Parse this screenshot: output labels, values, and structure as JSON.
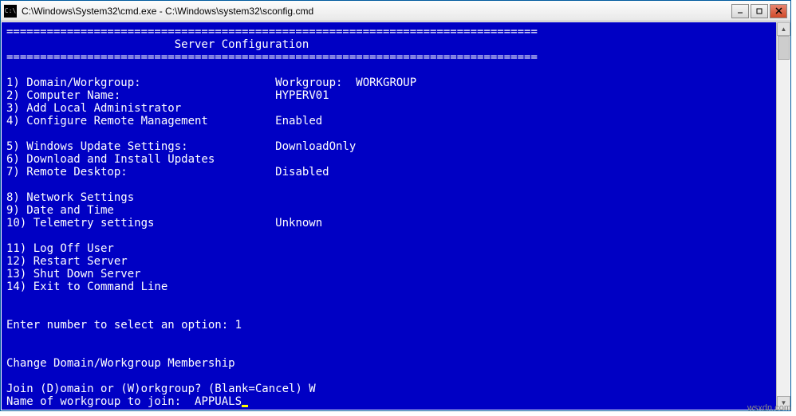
{
  "window": {
    "title": "C:\\Windows\\System32\\cmd.exe - C:\\Windows\\system32\\sconfig.cmd"
  },
  "header": {
    "rule": "===============================================================================",
    "title_indent": "                         ",
    "title": "Server Configuration"
  },
  "options": {
    "o1_label": "1) Domain/Workgroup:",
    "o1_value": "Workgroup:  WORKGROUP",
    "o2_label": "2) Computer Name:",
    "o2_value": "HYPERV01",
    "o3_label": "3) Add Local Administrator",
    "o4_label": "4) Configure Remote Management",
    "o4_value": "Enabled",
    "o5_label": "5) Windows Update Settings:",
    "o5_value": "DownloadOnly",
    "o6_label": "6) Download and Install Updates",
    "o7_label": "7) Remote Desktop:",
    "o7_value": "Disabled",
    "o8_label": "8) Network Settings",
    "o9_label": "9) Date and Time",
    "o10_label": "10) Telemetry settings",
    "o10_value": "Unknown",
    "o11_label": "11) Log Off User",
    "o12_label": "12) Restart Server",
    "o13_label": "13) Shut Down Server",
    "o14_label": "14) Exit to Command Line"
  },
  "prompts": {
    "select_prompt": "Enter number to select an option: ",
    "select_input": "1",
    "change_header": "Change Domain/Workgroup Membership",
    "join_prompt": "Join (D)omain or (W)orkgroup? (Blank=Cancel) ",
    "join_input": "W",
    "workgroup_prompt": "Name of workgroup to join:  ",
    "workgroup_input": "APPUALS"
  },
  "watermark": "wsxdn.com"
}
